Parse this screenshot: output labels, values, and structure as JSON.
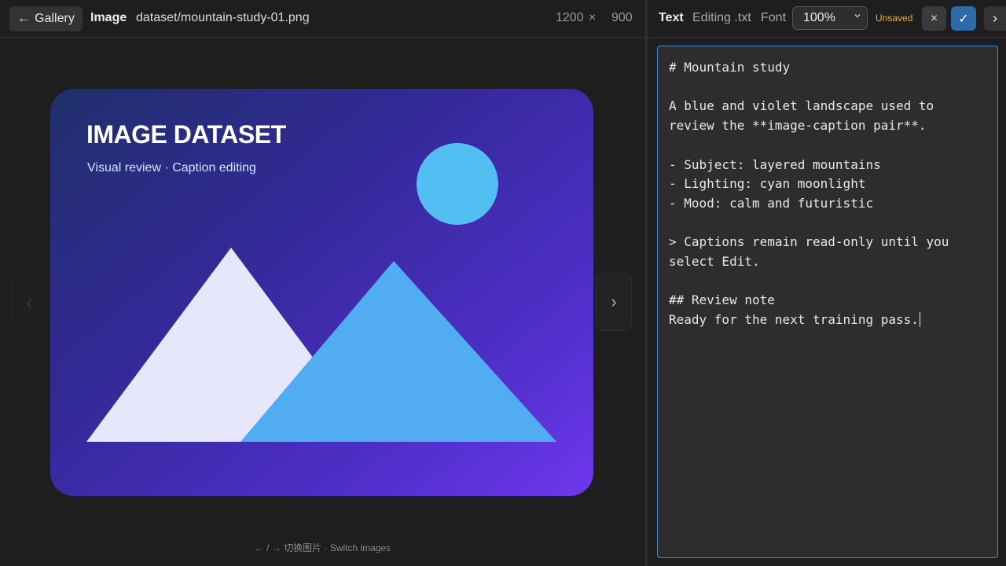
{
  "header": {
    "back_label": "Gallery",
    "back_icon": "arrow-left-icon",
    "section": "Image",
    "file_path": "dataset/mountain-study-01.png",
    "width": "1200",
    "times": "×",
    "height": "900"
  },
  "preview": {
    "title": "IMAGE DATASET",
    "subtitle": "Visual review · Caption editing",
    "prev_icon": "‹",
    "next_icon": "›",
    "hint": "← / → 切换图片 · Switch images",
    "colors": {
      "moon": "#52bef2",
      "left_mountain": "#e6e7fb",
      "right_mountain": "#52acf1"
    }
  },
  "editor_bar": {
    "title": "Text",
    "mode": "Editing .txt",
    "font_label": "Font",
    "zoom": "100%",
    "status": "Unsaved",
    "cancel_icon": "×",
    "confirm_icon": "✓",
    "more_icon": "›"
  },
  "editor": {
    "content": "# Mountain study\n\nA blue and violet landscape used to review the **image-caption pair**.\n\n- Subject: layered mountains\n- Lighting: cyan moonlight\n- Mood: calm and futuristic\n\n> Captions remain read-only until you select Edit.\n\n## Review note\nReady for the next training pass."
  }
}
